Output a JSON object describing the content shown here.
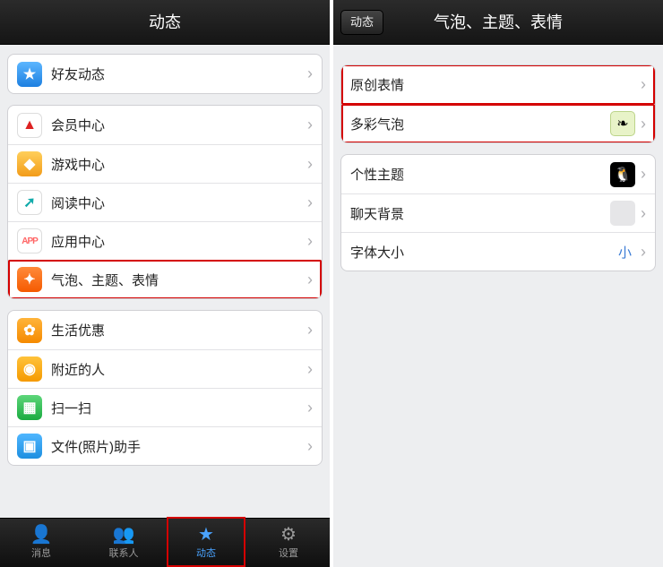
{
  "left": {
    "title": "动态",
    "groups": [
      [
        {
          "id": "friend-feed",
          "label": "好友动态",
          "icon": "star"
        }
      ],
      [
        {
          "id": "vip-center",
          "label": "会员中心",
          "icon": "vip"
        },
        {
          "id": "game-center",
          "label": "游戏中心",
          "icon": "game"
        },
        {
          "id": "read-center",
          "label": "阅读中心",
          "icon": "read"
        },
        {
          "id": "app-center",
          "label": "应用中心",
          "icon": "app"
        },
        {
          "id": "theme-bubble",
          "label": "气泡、主题、表情",
          "icon": "theme",
          "highlight": true
        }
      ],
      [
        {
          "id": "life-deals",
          "label": "生活优惠",
          "icon": "life"
        },
        {
          "id": "nearby",
          "label": "附近的人",
          "icon": "near"
        },
        {
          "id": "scan",
          "label": "扫一扫",
          "icon": "scan"
        },
        {
          "id": "file-helper",
          "label": "文件(照片)助手",
          "icon": "file"
        }
      ]
    ],
    "tabs": [
      {
        "id": "tab-msg",
        "label": "消息",
        "glyph": "person"
      },
      {
        "id": "tab-contacts",
        "label": "联系人",
        "glyph": "people"
      },
      {
        "id": "tab-feed",
        "label": "动态",
        "glyph": "star",
        "active": true,
        "highlight": true
      },
      {
        "id": "tab-settings",
        "label": "设置",
        "glyph": "gear"
      }
    ]
  },
  "right": {
    "back": "动态",
    "title": "气泡、主题、表情",
    "groups": [
      [
        {
          "id": "orig-emoji",
          "label": "原创表情",
          "highlight": true
        },
        {
          "id": "color-bubble",
          "label": "多彩气泡",
          "highlight": true,
          "rightIcon": "leaf"
        }
      ],
      [
        {
          "id": "theme",
          "label": "个性主题",
          "rightIcon": "peng"
        },
        {
          "id": "chat-bg",
          "label": "聊天背景",
          "rightIcon": "blank"
        },
        {
          "id": "font",
          "label": "字体大小",
          "valueText": "小"
        }
      ]
    ]
  },
  "iconGlyphs": {
    "star": "★",
    "vip": "▲",
    "game": "◆",
    "read": "➚",
    "app": "APP",
    "theme": "✦",
    "life": "✿",
    "near": "◉",
    "scan": "▦",
    "file": "▣",
    "peng": "🐧",
    "leaf": "❧",
    "blank": ""
  },
  "tabGlyphs": {
    "person": "👤",
    "people": "👥",
    "star": "★",
    "gear": "⚙"
  }
}
